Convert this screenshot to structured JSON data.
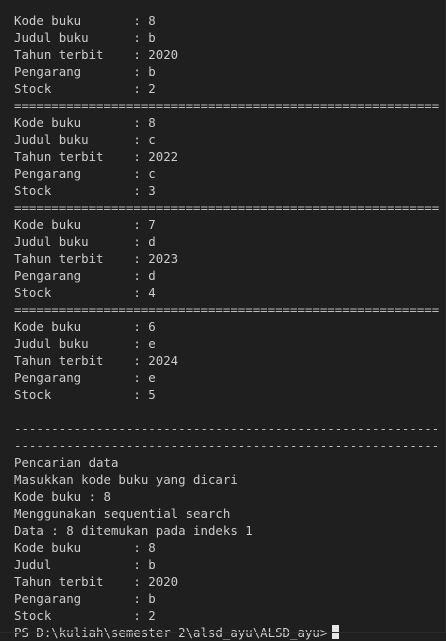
{
  "terminal": {
    "lines": [
      "Kode buku       : 8",
      "Judul buku      : b",
      "Tahun terbit    : 2020",
      "Pengarang       : b",
      "Stock           : 2",
      "=========================================================",
      "Kode buku       : 8",
      "Judul buku      : c",
      "Tahun terbit    : 2022",
      "Pengarang       : c",
      "Stock           : 3",
      "=========================================================",
      "Kode buku       : 7",
      "Judul buku      : d",
      "Tahun terbit    : 2023",
      "Pengarang       : d",
      "Stock           : 4",
      "=========================================================",
      "Kode buku       : 6",
      "Judul buku      : e",
      "Tahun terbit    : 2024",
      "Pengarang       : e",
      "Stock           : 5",
      "",
      "---------------------------------------------------------",
      "---------------------------------------------------------",
      "Pencarian data",
      "Masukkan kode buku yang dicari",
      "Kode buku : 8",
      "Menggunakan sequential search",
      "Data : 8 ditemukan pada indeks 1",
      "Kode buku       : 8",
      "Judul           : b",
      "Tahun terbit    : 2020",
      "Pengarang       : b",
      "Stock           : 2"
    ],
    "prompt": "PS D:\\kuliah\\semester 2\\alsd_ayu\\ALSD_ayu>"
  }
}
